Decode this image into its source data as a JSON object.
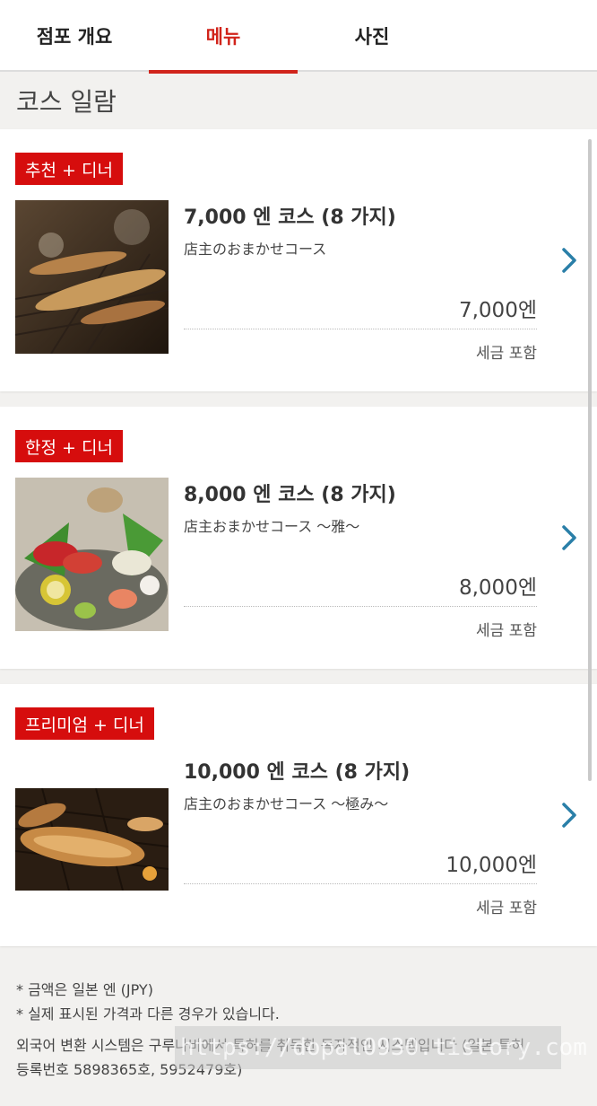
{
  "tabs": [
    {
      "label": "점포 개요",
      "active": false
    },
    {
      "label": "메뉴",
      "active": true
    },
    {
      "label": "사진",
      "active": false
    }
  ],
  "section_title": "코스 일람",
  "courses": [
    {
      "badge": "추천 + 디너",
      "name": "7,000 엔 코스 (8 가지)",
      "description": "店主のおまかせコース",
      "price": "7,000엔",
      "tax": "세금 포함",
      "image": "grilled-fish-photo"
    },
    {
      "badge": "한정 + 디너",
      "name": "8,000 엔 코스 (8 가지)",
      "description": "店主おまかせコース ～雅～",
      "price": "8,000엔",
      "tax": "세금 포함",
      "image": "sashimi-platter-photo"
    },
    {
      "badge": "프리미엄 + 디너",
      "name": "10,000 엔 코스 (8 가지)",
      "description": "店主のおまかせコース ～極み～",
      "price": "10,000엔",
      "tax": "세금 포함",
      "image": "grilled-fish-photo"
    }
  ],
  "notes": {
    "line1": "* 금액은 일본 엔 (JPY)",
    "line2": "* 실제 표시된 가격과 다른 경우가 있습니다.",
    "line3": "외국어 변환 시스템은 구루나비에서 특허를 취득한 독자적인 시스템입니다 (일본 특허",
    "line4": "등록번호 5898365호, 5952479호)"
  },
  "watermark": "https://dopal0930.tistory.com",
  "colors": {
    "accent": "#d1241b",
    "badge": "#d60d0d",
    "chevron": "#2a7fa8"
  }
}
